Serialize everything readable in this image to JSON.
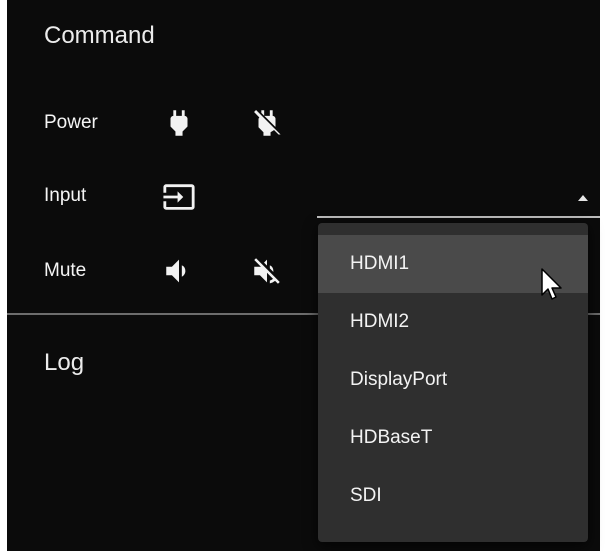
{
  "command": {
    "title": "Command",
    "rows": {
      "power": {
        "label": "Power",
        "icons": [
          "power-on-plug-icon",
          "power-off-plug-icon"
        ]
      },
      "input": {
        "label": "Input",
        "icons": [
          "input-icon"
        ]
      },
      "mute": {
        "label": "Mute",
        "icons": [
          "volume-icon",
          "volume-off-icon"
        ]
      }
    }
  },
  "input_select": {
    "options": [
      "HDMI1",
      "HDMI2",
      "DisplayPort",
      "HDBaseT",
      "SDI"
    ],
    "hovered": "HDMI1"
  },
  "log": {
    "title": "Log"
  },
  "colors": {
    "background": "#0b0b0b",
    "menu_background": "#2f2f2f",
    "menu_hover": "#4a4a4a",
    "text": "#f2f2f2"
  }
}
